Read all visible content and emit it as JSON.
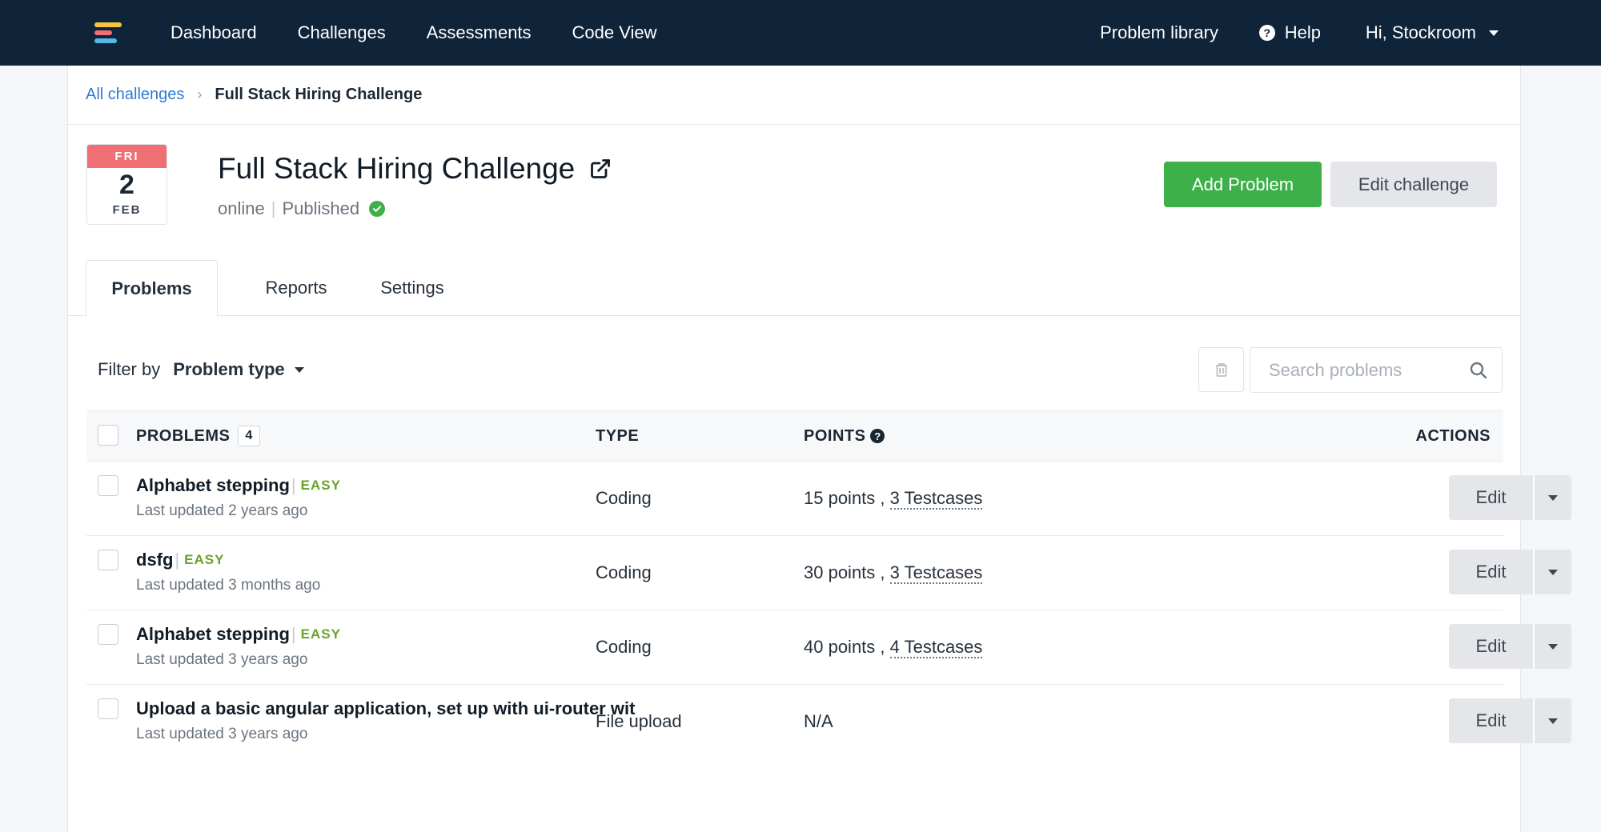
{
  "nav": {
    "items": [
      "Dashboard",
      "Challenges",
      "Assessments",
      "Code View"
    ],
    "problem_library": "Problem library",
    "help": "Help",
    "user_greeting": "Hi, Stockroom"
  },
  "colors": {
    "navbar": "#0f2339",
    "primary_green": "#3eb04a",
    "date_red": "#ef6f75",
    "link_blue": "#2d7bd2",
    "easy_green": "#6aa127"
  },
  "breadcrumb": {
    "parent": "All challenges",
    "current": "Full Stack Hiring Challenge"
  },
  "challenge": {
    "date": {
      "day": "FRI",
      "num": "2",
      "month": "FEB"
    },
    "title": "Full Stack Hiring Challenge",
    "mode": "online",
    "status": "Published"
  },
  "actions": {
    "add_problem": "Add Problem",
    "edit_challenge": "Edit challenge"
  },
  "tabs": [
    "Problems",
    "Reports",
    "Settings"
  ],
  "filter": {
    "label": "Filter by",
    "value": "Problem type"
  },
  "search": {
    "placeholder": "Search problems"
  },
  "table": {
    "headers": {
      "problems": "PROBLEMS",
      "count": "4",
      "type": "TYPE",
      "points": "POINTS",
      "actions": "ACTIONS"
    },
    "rows": [
      {
        "name": "Alphabet stepping",
        "level": "EASY",
        "updated": "Last updated 2 years ago",
        "type": "Coding",
        "points": "15 points , ",
        "testcases": "3 Testcases"
      },
      {
        "name": "dsfg",
        "level": "EASY",
        "updated": "Last updated 3 months ago",
        "type": "Coding",
        "points": "30 points , ",
        "testcases": "3 Testcases"
      },
      {
        "name": "Alphabet stepping",
        "level": "EASY",
        "updated": "Last updated 3 years ago",
        "type": "Coding",
        "points": "40 points , ",
        "testcases": "4 Testcases"
      },
      {
        "name": "Upload a basic angular application, set up with ui-router wit",
        "level": "",
        "updated": "Last updated 3 years ago",
        "type": "File upload",
        "points": "N/A",
        "testcases": ""
      }
    ],
    "edit_label": "Edit"
  }
}
